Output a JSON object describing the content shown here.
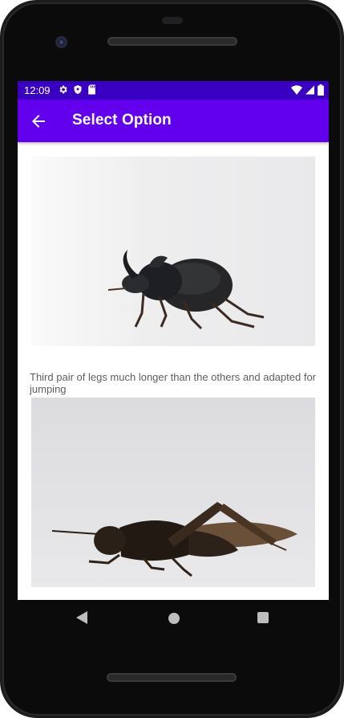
{
  "status_bar": {
    "time": "12:09",
    "left_icons": [
      "gear-icon",
      "shield-icon",
      "sd-card-icon"
    ],
    "right_icons": [
      "wifi-icon",
      "signal-icon",
      "battery-icon"
    ],
    "color": "#3a00c2"
  },
  "app_bar": {
    "title": "Select Option",
    "back_icon": "arrow-left-icon",
    "color": "#6200ee"
  },
  "options": [
    {
      "image": "rhinoceros-beetle-photo",
      "text": "Third pair of legs much longer than the others and adapted for jumping"
    },
    {
      "image": "grasshopper-photo"
    }
  ],
  "nav_bar": {
    "icons": [
      "back-triangle-icon",
      "home-circle-icon",
      "recents-square-icon"
    ]
  }
}
